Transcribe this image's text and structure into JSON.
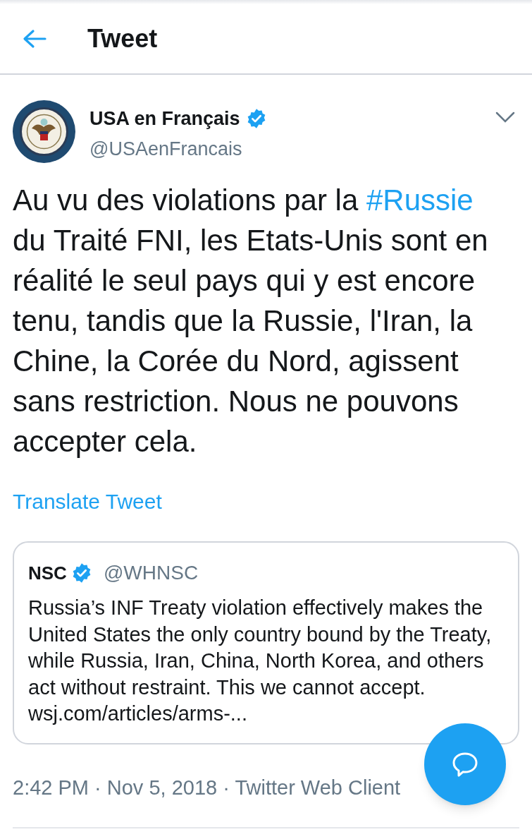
{
  "header": {
    "title": "Tweet"
  },
  "tweet": {
    "author": {
      "name": "USA en Français",
      "verified": true,
      "handle": "@USAenFrancais"
    },
    "text_parts": [
      {
        "kind": "plain",
        "text": "Au vu des violations par la "
      },
      {
        "kind": "hashtag",
        "text": "#Russie"
      },
      {
        "kind": "plain",
        "text": " du Traité FNI, les Etats-Unis sont en réalité le seul pays qui y est encore tenu, tandis que la Russie, l'Iran, la Chine, la Corée du Nord, agissent sans restriction. Nous ne pouvons accepter cela."
      }
    ],
    "translate": "Translate Tweet",
    "quoted": {
      "name": "NSC",
      "verified": true,
      "handle": "@WHNSC",
      "text": "Russia’s INF Treaty violation effectively makes the United States the only country bound by the Treaty, while Russia, Iran, China, North Korea, and others act without restraint. This we cannot accept. wsj.com/articles/arms-..."
    },
    "meta": "2:42 PM · Nov 5, 2018 · Twitter Web Client"
  }
}
